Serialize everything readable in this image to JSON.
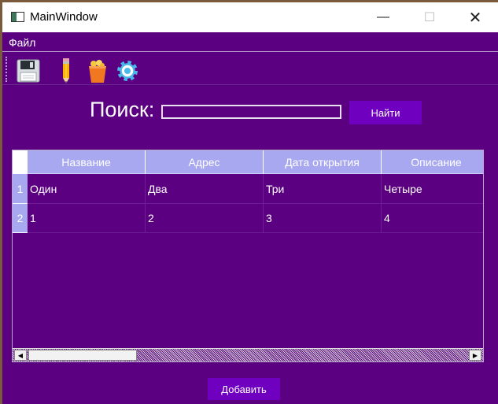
{
  "window": {
    "title": "MainWindow",
    "minimize": "—",
    "maximize": "☐",
    "close": "✕"
  },
  "menu": {
    "file": "Файл"
  },
  "toolbar": {
    "icons": [
      "save-icon",
      "pencil-icon",
      "trash-bin-icon",
      "gear-icon"
    ]
  },
  "search": {
    "label": "Поиск:",
    "value": "",
    "button": "Найти"
  },
  "table": {
    "columns": [
      "Название",
      "Адрес",
      "Дата открытия",
      "Описание"
    ],
    "row_numbers": [
      "1",
      "2"
    ],
    "rows": [
      [
        "Один",
        "Два",
        "Три",
        "Четыре"
      ],
      [
        "1",
        "2",
        "3",
        "4"
      ]
    ]
  },
  "add_button": "Добавить",
  "colors": {
    "background": "#5a0080",
    "accent_button": "#7000c0",
    "header": "#a8a8f0"
  }
}
